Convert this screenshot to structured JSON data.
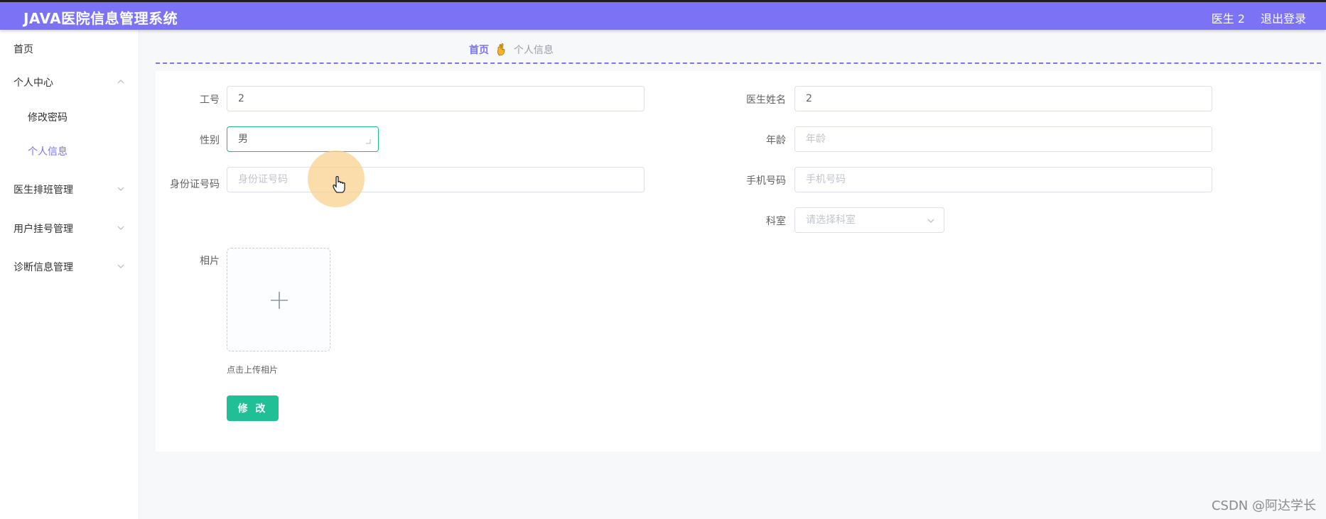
{
  "header": {
    "title": "JAVA医院信息管理系统",
    "user": "医生 2",
    "logout": "退出登录",
    "accent_color": "#7b72f6"
  },
  "sidebar": {
    "items": [
      {
        "label": "首页"
      },
      {
        "label": "个人中心",
        "expanded": true
      },
      {
        "label": "修改密码",
        "sub": true
      },
      {
        "label": "个人信息",
        "sub": true,
        "active": true
      },
      {
        "label": "医生排班管理",
        "expanded": false
      },
      {
        "label": "用户挂号管理",
        "expanded": false
      },
      {
        "label": "诊断信息管理",
        "expanded": false
      }
    ]
  },
  "breadcrumb": {
    "home": "首页",
    "separator_icon": "hand-emoji-icon",
    "current": "个人信息"
  },
  "form": {
    "job_no": {
      "label": "工号",
      "value": "2"
    },
    "doctor_name": {
      "label": "医生姓名",
      "value": "2"
    },
    "gender": {
      "label": "性别",
      "value": "男"
    },
    "age": {
      "label": "年龄",
      "value": "",
      "placeholder": "年龄"
    },
    "id_card": {
      "label": "身份证号码",
      "value": "",
      "placeholder": "身份证号码"
    },
    "phone": {
      "label": "手机号码",
      "value": "",
      "placeholder": "手机号码"
    },
    "department": {
      "label": "科室",
      "placeholder": "请选择科室"
    },
    "photo": {
      "label": "相片",
      "tip": "点击上传相片"
    },
    "submit_label": "修 改"
  },
  "colors": {
    "submit_button": "#1fc096",
    "focus_border": "#1aba95"
  },
  "watermark": "CSDN @阿达学长"
}
